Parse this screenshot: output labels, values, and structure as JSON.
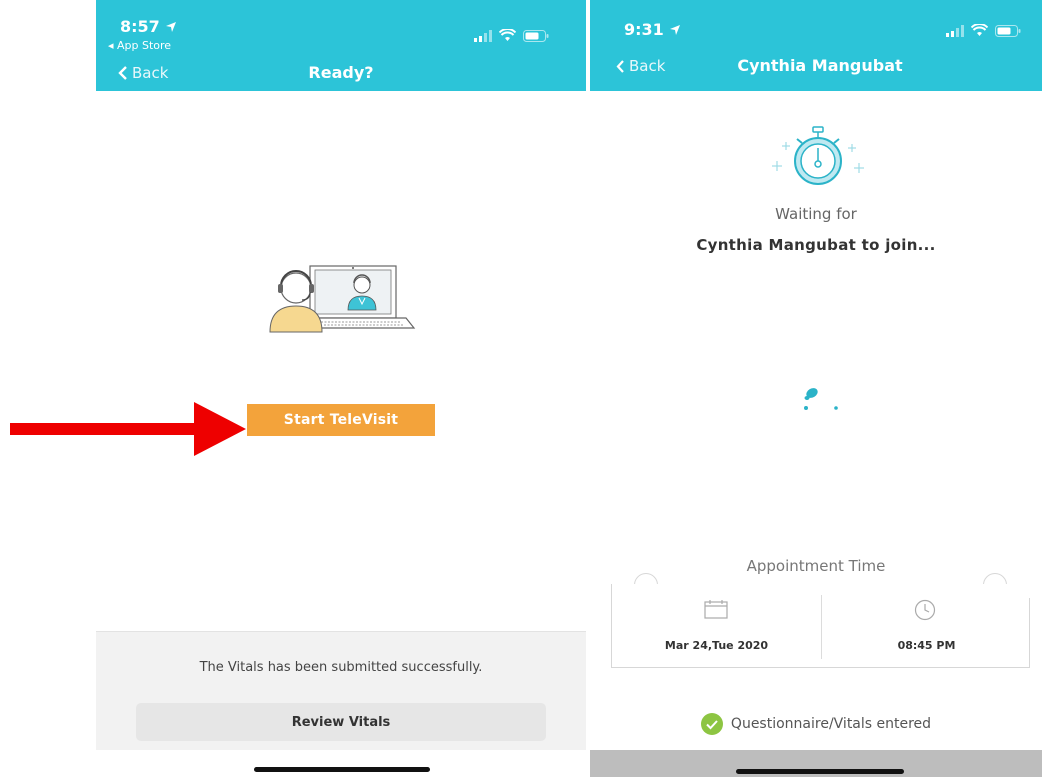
{
  "colors": {
    "teal": "#2cc4d8",
    "orange": "#f3a33b",
    "red_arrow": "#ee0000",
    "green_check": "#8dc542",
    "gray_button": "#e6e6e6"
  },
  "left_screen": {
    "status": {
      "time": "8:57",
      "location_icon": "location-arrow-icon",
      "back_to_app": "◂ App Store"
    },
    "nav": {
      "back_label": "Back",
      "title": "Ready?"
    },
    "illustration": "patient-doctor-televisit-illustration",
    "start_button": "Start TeleVisit",
    "footer": {
      "message": "The Vitals has been submitted successfully.",
      "review_button": "Review Vitals"
    }
  },
  "right_screen": {
    "status": {
      "time": "9:31",
      "location_icon": "location-arrow-icon"
    },
    "nav": {
      "back_label": "Back",
      "title": "Cynthia Mangubat"
    },
    "waiting_line_1": "Waiting for",
    "waiting_line_2": "Cynthia Mangubat to join...",
    "appointment": {
      "label": "Appointment Time",
      "date": "Mar 24,Tue 2020",
      "time": "08:45 PM"
    },
    "check_status": "Questionnaire/Vitals entered"
  }
}
